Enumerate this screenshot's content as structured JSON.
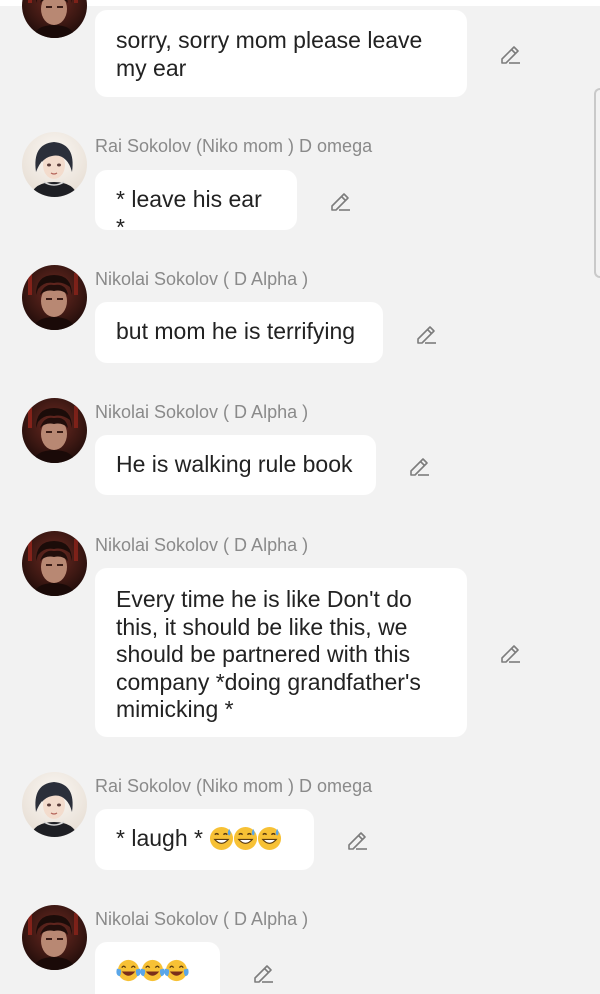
{
  "messages": [
    {
      "sender": "",
      "avatar": "niko-avatar-icon",
      "text": "sorry, sorry mom please leave my ear"
    },
    {
      "sender": "Rai Sokolov (Niko mom ) D omega",
      "avatar": "rai-avatar-icon",
      "text": "* leave his ear *"
    },
    {
      "sender": "Nikolai Sokolov ( D Alpha )",
      "avatar": "niko-avatar-icon",
      "text": "but mom he is terrifying"
    },
    {
      "sender": "Nikolai Sokolov ( D Alpha )",
      "avatar": "niko-avatar-icon",
      "text": "He is walking rule book"
    },
    {
      "sender": "Nikolai Sokolov ( D Alpha )",
      "avatar": "niko-avatar-icon",
      "text": "Every time he is like Don't do this, it should be like this, we should be partnered with this company *doing grandfather's mimicking *"
    },
    {
      "sender": "Rai Sokolov (Niko mom ) D omega",
      "avatar": "rai-avatar-icon",
      "text": "* laugh * ",
      "emoji": [
        "sweat-smile-emoji-icon",
        "sweat-smile-emoji-icon",
        "sweat-smile-emoji-icon"
      ]
    },
    {
      "sender": "Nikolai Sokolov ( D Alpha )",
      "avatar": "niko-avatar-icon",
      "text": "",
      "emoji": [
        "tears-of-joy-emoji-icon",
        "tears-of-joy-emoji-icon",
        "tears-of-joy-emoji-icon"
      ]
    }
  ],
  "icons": {
    "edit": "pencil-edit-icon"
  },
  "colors": {
    "background": "#f2f2f2",
    "bubble": "#ffffff",
    "sender_name": "#8a8a8a",
    "message_text": "#222222"
  }
}
